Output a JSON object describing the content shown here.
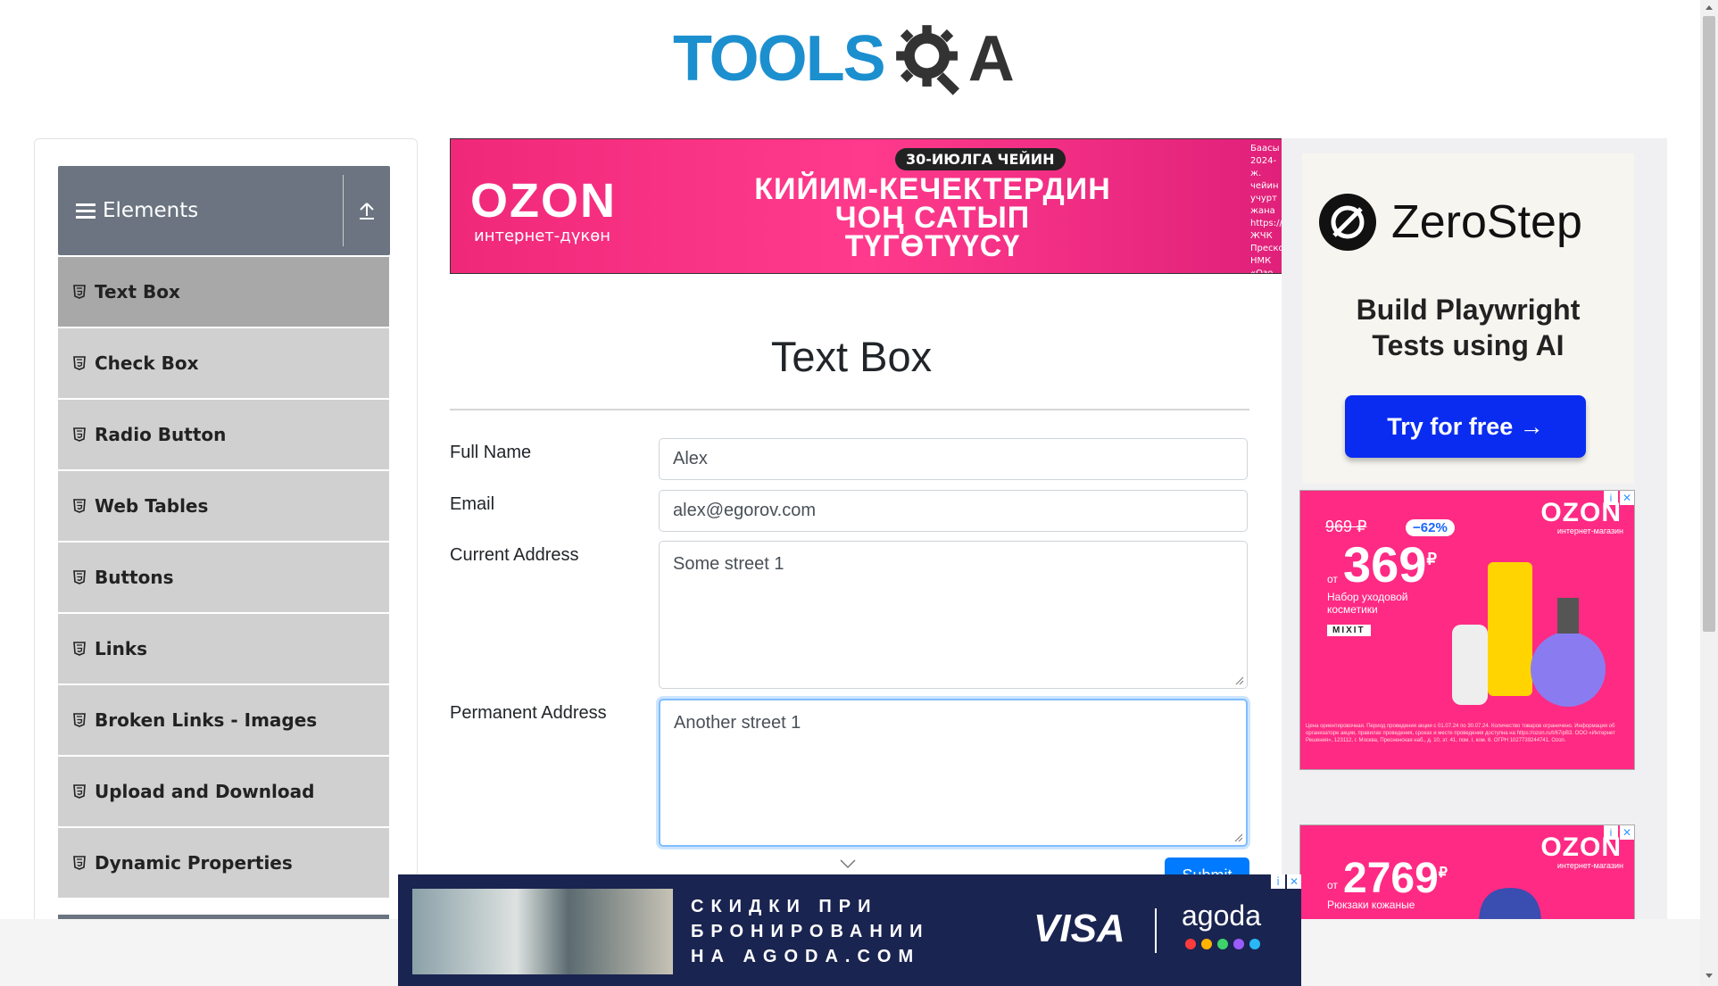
{
  "logo": {
    "left_text": "TOOLS",
    "right_text": "A"
  },
  "sidebar": {
    "group_title": "Elements",
    "items": [
      {
        "label": "Text Box",
        "active": true
      },
      {
        "label": "Check Box"
      },
      {
        "label": "Radio Button"
      },
      {
        "label": "Web Tables"
      },
      {
        "label": "Buttons"
      },
      {
        "label": "Links"
      },
      {
        "label": "Broken Links - Images"
      },
      {
        "label": "Upload and Download"
      },
      {
        "label": "Dynamic Properties"
      }
    ]
  },
  "top_ad": {
    "brand": "OZON",
    "brand_sub": "интернет-дүкөн",
    "pill": "30-ИЮЛГА ЧЕЙИН",
    "headline_1": "КИЙИМ-КЕЧЕКТЕРДИН",
    "headline_2": "ЧОҢ САТЫП",
    "headline_3": "ТҮГӨТҮҮСҮ",
    "fine_print": "Баасы 2024-ж. чейин учурт жана https:// ЖЧК Преско НМК «Озо"
  },
  "main": {
    "title": "Text Box",
    "form": {
      "full_name_label": "Full Name",
      "full_name_value": "Alex",
      "email_label": "Email",
      "email_value": "alex@egorov.com",
      "current_address_label": "Current Address",
      "current_address_value": "Some street 1",
      "permanent_address_label": "Permanent Address",
      "permanent_address_value": "Another street 1",
      "submit_label": "Submit"
    }
  },
  "zerostep_ad": {
    "name": "ZeroStep",
    "tagline_1": "Build Playwright",
    "tagline_2": "Tests using AI",
    "cta": "Try for free →"
  },
  "ozon_ad_1": {
    "logo": "OZON",
    "logo_sub": "интернет-магазин",
    "old_price": "969 ₽",
    "discount": "−62%",
    "price": "369",
    "currency": "₽",
    "from": "от",
    "description": "Набор уходовой косметики",
    "brand": "MIXIT",
    "legal": "Цена ориентировочная. Период проведения акции с 01.07.24 по 30.07.24. Количество товаров ограничено. Информация об организаторе акции, правилах проведения, сроках и месте проведения доступна на https://ozon.ru/t/67ipB3. ООО «Интернет Решения», 123112, г. Москва, Пресненская наб., д. 10, эт. 41, пом. I, ком. 6. ОГРН 1027739244741. Ozon."
  },
  "ozon_ad_2": {
    "logo": "OZON",
    "logo_sub": "интернет-магазин",
    "price": "2769",
    "currency": "₽",
    "from": "от",
    "description": "Рюкзаки кожаные"
  },
  "bottom_ad": {
    "headline": "СКИДКИ ПРИ БРОНИРОВАНИИ НА AGODA.COM",
    "visa": "VISA",
    "agoda": "agoda"
  },
  "colors": {
    "sidebar_header": "#6b7480",
    "sidebar_item": "#d0d0d0",
    "sidebar_item_active": "#a8a8a8",
    "logo_blue": "#1C8FCF",
    "submit_blue": "#007bff",
    "ozon_pink": "#ff2a84",
    "zerostep_cta": "#0a2cf0"
  }
}
